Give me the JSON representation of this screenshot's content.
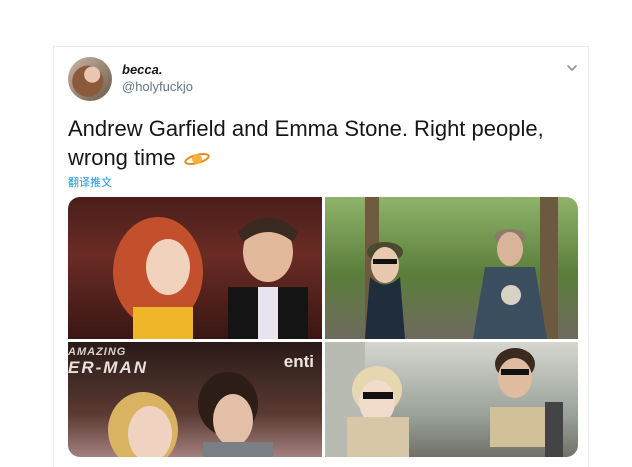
{
  "tweet": {
    "display_name": "becca.",
    "handle": "@holyfuckjo",
    "text": "Andrew Garfield and Emma Stone. Right people, wrong time",
    "translate_label": "翻译推文"
  },
  "photos": [
    {
      "banner": ""
    },
    {
      "banner": ""
    },
    {
      "banner_top": "AMAZING",
      "banner_main": "ER-MAN",
      "banner_right": "enti"
    },
    {
      "banner": ""
    }
  ],
  "icons": {
    "menu": "chevron-down-icon",
    "emoji": "ringed-planet-icon"
  },
  "colors": {
    "link": "#1b95e0",
    "text": "#14171a",
    "secondary": "#657786"
  }
}
